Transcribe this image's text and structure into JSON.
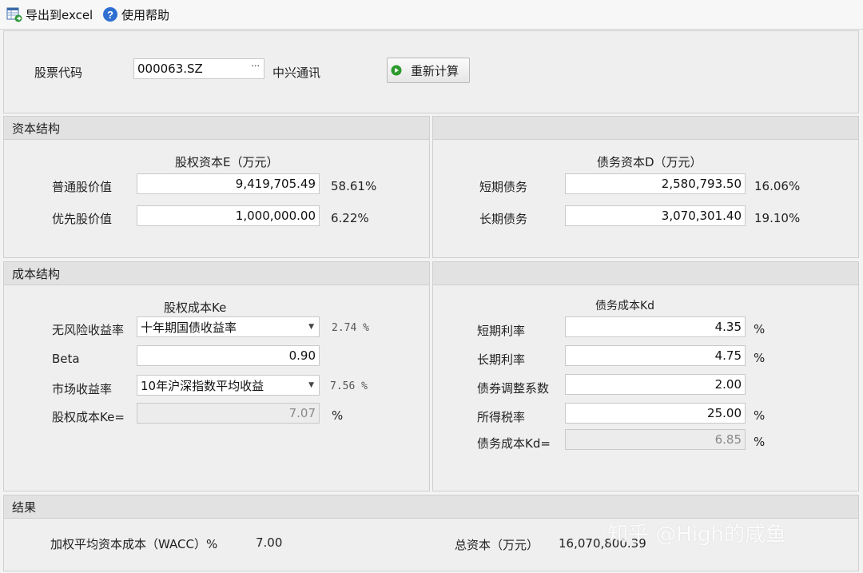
{
  "toolbar": {
    "export_label": "导出到excel",
    "help_label": "使用帮助",
    "export_icon": "excel-export-icon",
    "help_icon": "question-circle-icon"
  },
  "header": {
    "stock_code_label": "股票代码",
    "stock_code_value": "000063.SZ",
    "stock_picker_glyph": "···",
    "company_name": "中兴通讯",
    "recalc_label": "重新计算",
    "recalc_icon": "play-circle-icon"
  },
  "capital_structure": {
    "title": "资本结构",
    "equity": {
      "heading": "股权资本E（万元）",
      "common_label": "普通股价值",
      "common_value": "9,419,705.49",
      "common_pct": "58.61%",
      "preferred_label": "优先股价值",
      "preferred_value": "1,000,000.00",
      "preferred_pct": "6.22%"
    },
    "debt": {
      "heading": "债务资本D（万元）",
      "short_label": "短期债务",
      "short_value": "2,580,793.50",
      "short_pct": "16.06%",
      "long_label": "长期债务",
      "long_value": "3,070,301.40",
      "long_pct": "19.10%"
    }
  },
  "cost_structure": {
    "title": "成本结构",
    "equity": {
      "heading": "股权成本Ke",
      "rf_label": "无风险收益率",
      "rf_select": "十年期国债收益率",
      "rf_value": "2.74 %",
      "beta_label": "Beta",
      "beta_value": "0.90",
      "market_label": "市场收益率",
      "market_select": "10年沪深指数平均收益",
      "market_value": "7.56 %",
      "ke_label": "股权成本Ke=",
      "ke_value": "7.07",
      "ke_unit": "%"
    },
    "debt": {
      "heading": "债务成本Kd",
      "short_rate_label": "短期利率",
      "short_rate_value": "4.35",
      "short_rate_unit": "%",
      "long_rate_label": "长期利率",
      "long_rate_value": "4.75",
      "long_rate_unit": "%",
      "adj_label": "债券调整系数",
      "adj_value": "2.00",
      "tax_label": "所得税率",
      "tax_value": "25.00",
      "tax_unit": "%",
      "kd_label": "债务成本Kd=",
      "kd_value": "6.85",
      "kd_unit": "%"
    }
  },
  "result": {
    "title": "结果",
    "wacc_label": "加权平均资本成本（WACC）%",
    "wacc_value": "7.00",
    "total_label": "总资本（万元）",
    "total_value": "16,070,800.39"
  },
  "watermark": "知乎 @High的咸鱼"
}
